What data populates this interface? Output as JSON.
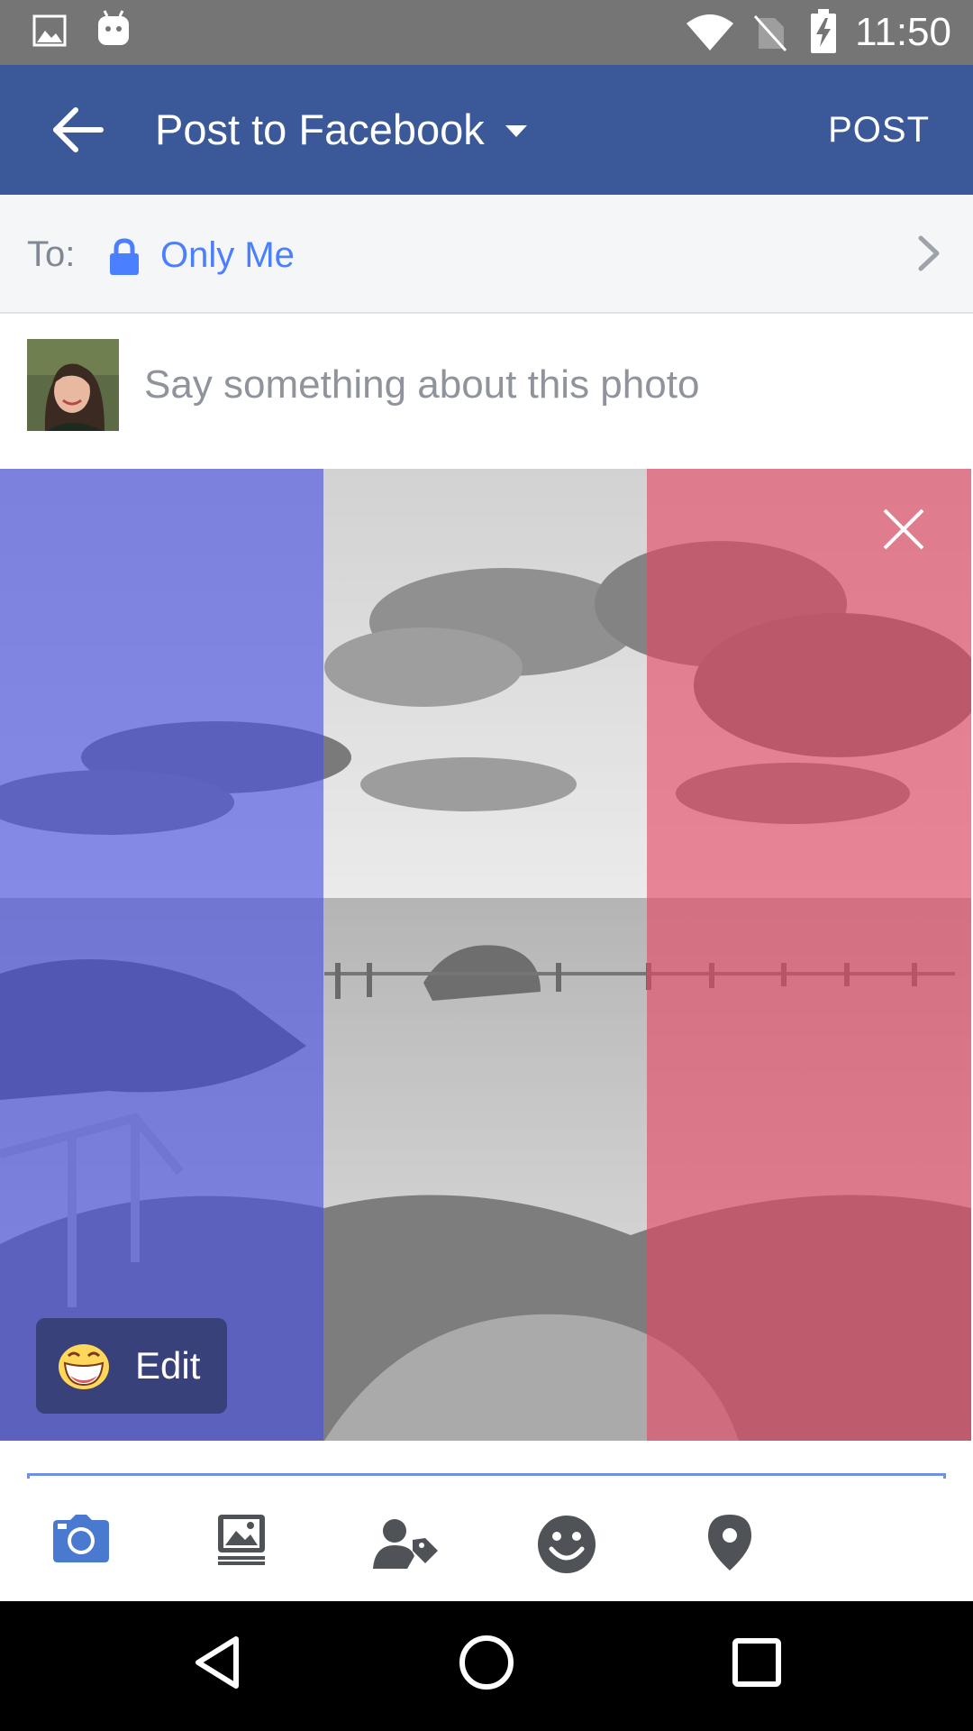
{
  "status_bar": {
    "time": "11:50",
    "icons": [
      "image-notification-icon",
      "android-robot-icon",
      "wifi-icon",
      "no-sim-icon",
      "battery-charging-icon"
    ]
  },
  "app_bar": {
    "title": "Post to Facebook",
    "post_label": "POST"
  },
  "audience": {
    "to_label": "To:",
    "value": "Only Me"
  },
  "composer": {
    "placeholder": "Say something about this photo"
  },
  "photo": {
    "edit_label": "Edit",
    "filter_colors": [
      "#5a63e0",
      "#c9c9c9",
      "#e35c74"
    ]
  },
  "toolbar": {
    "items": [
      "camera-icon",
      "photo-gallery-icon",
      "tag-people-icon",
      "feeling-icon",
      "location-icon"
    ],
    "accent": "#3b5998"
  },
  "navigation": {
    "items": [
      "back-icon",
      "home-icon",
      "recents-icon"
    ]
  }
}
